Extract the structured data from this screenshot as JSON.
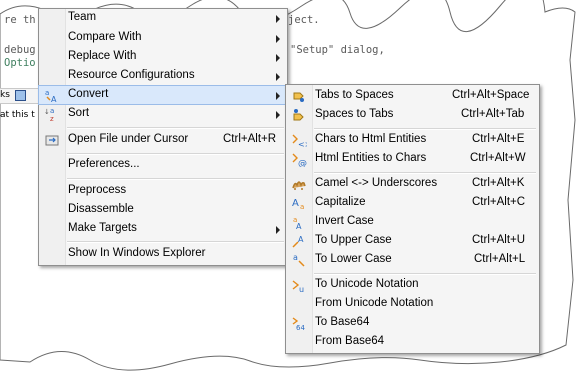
{
  "editor": {
    "line1_left": "re th",
    "line1_right": "ject.",
    "line2_left": "debug",
    "line2_right": "\"Setup\" dialog,",
    "line3_left": "Optio",
    "tab_fragment": "ks",
    "row_fragment": "at this t"
  },
  "context_menu": {
    "items": [
      {
        "label": "Team",
        "accel": "",
        "submenu": true
      },
      {
        "label": "Compare With",
        "accel": "",
        "submenu": true
      },
      {
        "label": "Replace With",
        "accel": "",
        "submenu": true
      },
      {
        "label": "Resource Configurations",
        "accel": "",
        "submenu": true
      },
      {
        "label": "Convert",
        "accel": "",
        "submenu": true,
        "icon": "convert-icon"
      },
      {
        "label": "Sort",
        "accel": "",
        "submenu": true,
        "icon": "sort-icon"
      },
      {
        "label": "Open File under Cursor",
        "accel": "Ctrl+Alt+R",
        "icon": "open-file-icon"
      },
      {
        "label": "Preferences...",
        "accel": ""
      },
      {
        "label": "Preprocess",
        "accel": ""
      },
      {
        "label": "Disassemble",
        "accel": ""
      },
      {
        "label": "Make Targets",
        "accel": "",
        "submenu": true
      },
      {
        "label": "Show In Windows Explorer",
        "accel": ""
      }
    ]
  },
  "convert_menu": {
    "items": [
      {
        "label": "Tabs to Spaces",
        "accel": "Ctrl+Alt+Space",
        "icon": "tabs-to-spaces-icon"
      },
      {
        "label": "Spaces to Tabs",
        "accel": "Ctrl+Alt+Tab",
        "icon": "spaces-to-tabs-icon"
      },
      {
        "label": "Chars to Html Entities",
        "accel": "Ctrl+Alt+E",
        "icon": "chars-to-html-icon"
      },
      {
        "label": "Html Entities to Chars",
        "accel": "Ctrl+Alt+W",
        "icon": "html-to-chars-icon"
      },
      {
        "label": "Camel <-> Underscores",
        "accel": "Ctrl+Alt+K",
        "icon": "camel-icon"
      },
      {
        "label": "Capitalize",
        "accel": "Ctrl+Alt+C",
        "icon": "capitalize-icon"
      },
      {
        "label": "Invert Case",
        "accel": "",
        "icon": "invert-case-icon"
      },
      {
        "label": "To Upper Case",
        "accel": "Ctrl+Alt+U",
        "icon": "upper-case-icon"
      },
      {
        "label": "To Lower Case",
        "accel": "Ctrl+Alt+L",
        "icon": "lower-case-icon"
      },
      {
        "label": "To Unicode Notation",
        "accel": "",
        "icon": "unicode-icon"
      },
      {
        "label": "From Unicode Notation",
        "accel": ""
      },
      {
        "label": "To Base64",
        "accel": "",
        "icon": "base64-icon"
      },
      {
        "label": "From Base64",
        "accel": ""
      }
    ]
  },
  "colors": {
    "highlight": "#d9e8fb",
    "menu_bg": "#f5f5f5"
  }
}
